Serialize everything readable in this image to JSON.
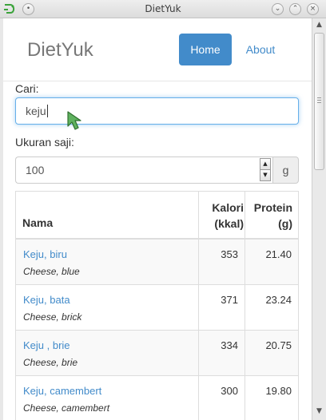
{
  "window": {
    "title": "DietYuk"
  },
  "nav": {
    "brand": "DietYuk",
    "home": "Home",
    "about": "About"
  },
  "search": {
    "label": "Cari:",
    "value": "keju"
  },
  "serving": {
    "label": "Ukuran saji:",
    "value": "100",
    "unit": "g"
  },
  "table": {
    "headers": {
      "name": "Nama",
      "calorie_line1": "Kalori",
      "calorie_line2": "(kkal)",
      "protein_line1": "Protein",
      "protein_line2": "(g)"
    },
    "rows": [
      {
        "name": "Keju, biru",
        "english": "Cheese, blue",
        "calories": "353",
        "protein": "21.40"
      },
      {
        "name": "Keju, bata",
        "english": "Cheese, brick",
        "calories": "371",
        "protein": "23.24"
      },
      {
        "name": "Keju , brie",
        "english": "Cheese, brie",
        "calories": "334",
        "protein": "20.75"
      },
      {
        "name": "Keju, camembert",
        "english": "Cheese, camembert",
        "calories": "300",
        "protein": "19.80"
      }
    ]
  },
  "colors": {
    "primary": "#428bca",
    "focus_border": "#66afe9",
    "brand_text": "#777777"
  }
}
